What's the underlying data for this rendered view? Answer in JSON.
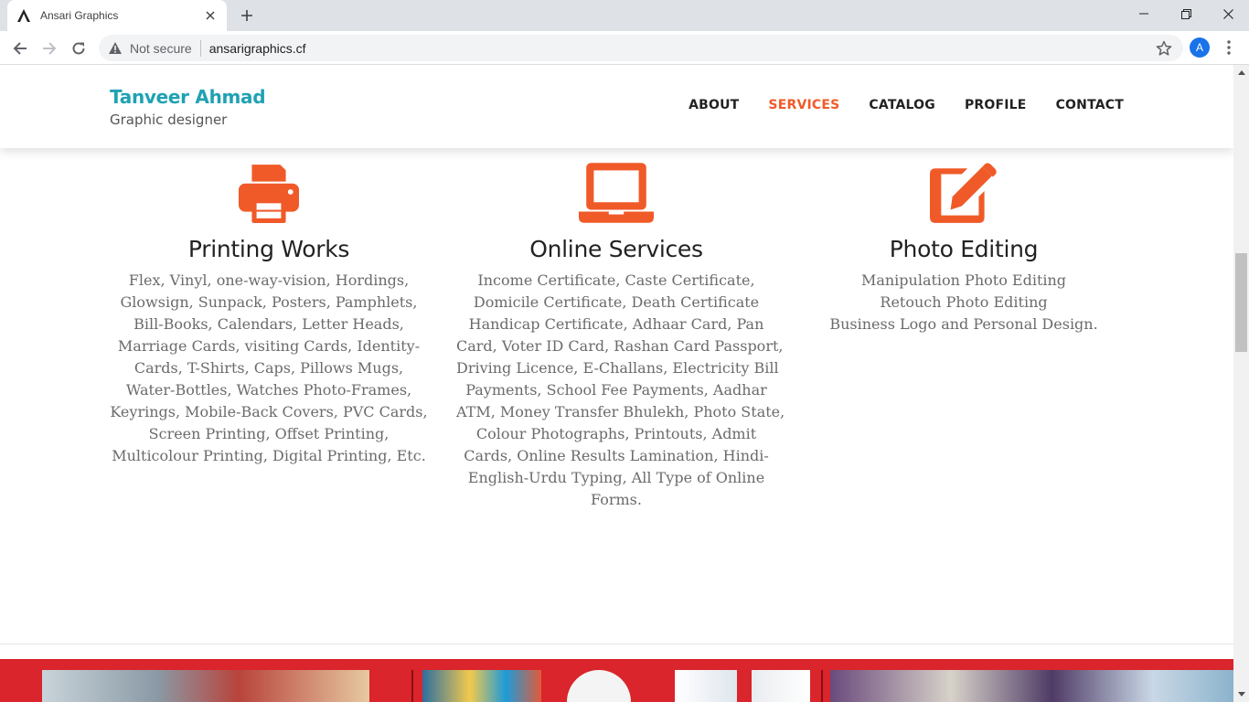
{
  "browser": {
    "tab_title": "Ansari Graphics",
    "security_label": "Not secure",
    "url": "ansarigraphics.cf",
    "profile_initial": "A"
  },
  "site": {
    "name": "Tanveer Ahmad",
    "tagline": "Graphic designer"
  },
  "nav": [
    {
      "label": "ABOUT",
      "active": false
    },
    {
      "label": "SERVICES",
      "active": true
    },
    {
      "label": "CATALOG",
      "active": false
    },
    {
      "label": "PROFILE",
      "active": false
    },
    {
      "label": "CONTACT",
      "active": false
    }
  ],
  "colors": {
    "accent": "#f05a28",
    "brand": "#1fa2b3",
    "banner": "#d9252b"
  },
  "services": [
    {
      "icon": "printer-icon",
      "title": "Printing Works",
      "lines": [
        "Flex, Vinyl, one-way-vision, Hordings,",
        "Glowsign, Sunpack, Posters, Pamphlets,",
        "Bill-Books, Calendars, Letter Heads,",
        "Marriage Cards, visiting Cards, Identity-",
        "Cards, T-Shirts, Caps, Pillows Mugs,",
        "Water-Bottles, Watches Photo-Frames,",
        "Keyrings, Mobile-Back Covers, PVC Cards,",
        "Screen Printing, Offset Printing,",
        "Multicolour Printing, Digital Printing, Etc."
      ]
    },
    {
      "icon": "laptop-icon",
      "title": "Online Services",
      "lines": [
        "Income Certificate, Caste Certificate,",
        "Domicile Certificate, Death Certificate",
        "Handicap Certificate, Adhaar Card, Pan",
        "Card, Voter ID Card, Rashan Card Passport,",
        "Driving Licence, E-Challans, Electricity Bill",
        "Payments, School Fee Payments, Aadhar",
        "ATM, Money Transfer Bhulekh, Photo State,",
        "Colour Photographs, Printouts, Admit",
        "Cards, Online Results Lamination, Hindi-",
        "English-Urdu Typing, All Type of Online",
        "Forms."
      ]
    },
    {
      "icon": "edit-icon",
      "title": "Photo Editing",
      "lines": [
        "Manipulation Photo Editing",
        "Retouch Photo Editing",
        "Business Logo and Personal Design."
      ]
    }
  ]
}
